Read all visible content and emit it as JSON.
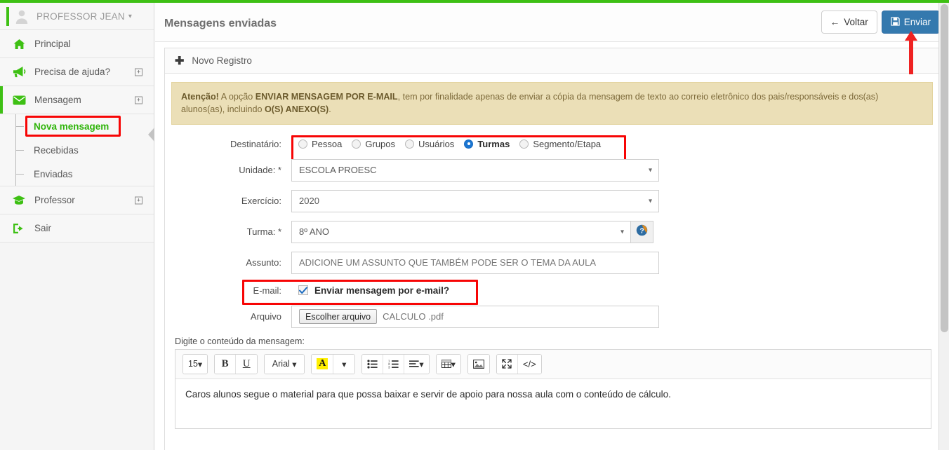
{
  "theme": {
    "brand_green": "#3ec014",
    "primary_blue": "#3479ae",
    "alert_bg": "#ebdfb7",
    "highlight_red": "#f70505",
    "radio_selected_blue": "#1b76d2"
  },
  "sidebar": {
    "user": {
      "name": "PROFESSOR JEAN",
      "caret": "chevron-down-icon"
    },
    "items": [
      {
        "label": "Principal",
        "icon": "home-icon",
        "expandable": false
      },
      {
        "label": "Precisa de ajuda?",
        "icon": "bullhorn-icon",
        "expandable": true
      },
      {
        "label": "Mensagem",
        "icon": "envelope-icon",
        "expandable": true
      }
    ],
    "submenu": [
      {
        "label": "Nova mensagem",
        "selected": true
      },
      {
        "label": "Recebidas",
        "selected": false
      },
      {
        "label": "Enviadas",
        "selected": false
      }
    ],
    "items_after": [
      {
        "label": "Professor",
        "icon": "graduation-cap-icon",
        "expandable": true
      },
      {
        "label": "Sair",
        "icon": "logout-icon",
        "expandable": false
      }
    ],
    "collapse_button": "collapse-sidebar-icon"
  },
  "header": {
    "title": "Mensagens enviadas",
    "back_label": "Voltar",
    "submit_label": "Enviar"
  },
  "panel": {
    "header_label": "Novo Registro",
    "alert": {
      "prefix_bold": "Atenção!",
      "text_1": " A opção ",
      "bold_1": "ENVIAR MENSAGEM POR E-MAIL",
      "text_2": ", tem por finalidade apenas de enviar a cópia da mensagem de texto ao correio eletrônico dos pais/responsáveis e dos(as) alunos(as), incluindo ",
      "bold_2": "O(S) ANEXO(S)",
      "text_3": "."
    }
  },
  "form": {
    "recipient": {
      "label": "Destinatário:",
      "options": [
        {
          "label": "Pessoa",
          "selected": false
        },
        {
          "label": "Grupos",
          "selected": false
        },
        {
          "label": "Usuários",
          "selected": false
        },
        {
          "label": "Turmas",
          "selected": true
        },
        {
          "label": "Segmento/Etapa",
          "selected": false
        }
      ]
    },
    "unidade": {
      "label": "Unidade: *",
      "value": "ESCOLA PROESC",
      "control": "select"
    },
    "exercicio": {
      "label": "Exercício:",
      "value": "2020",
      "control": "select"
    },
    "turma": {
      "label": "Turma: *",
      "value": "8º ANO",
      "control": "select",
      "help_icon": "question-circle-icon"
    },
    "assunto": {
      "label": "Assunto:",
      "value": "",
      "placeholder": "ADICIONE UM ASSUNTO QUE TAMBÉM PODE SER O TEMA DA AULA"
    },
    "email": {
      "label": "E-mail:",
      "checkbox_label": "Enviar mensagem por e-mail?",
      "checked": true
    },
    "arquivo": {
      "label": "Arquivo",
      "button_label": "Escolher arquivo",
      "file_name": "CALCULO .pdf"
    }
  },
  "editor": {
    "caption": "Digite o conteúdo da mensagem:",
    "toolbar": [
      {
        "name": "font-size-dropdown",
        "label": "15",
        "caret": true
      },
      {
        "name": "bold-button",
        "label": "B",
        "caret": false
      },
      {
        "name": "underline-button",
        "label": "U",
        "caret": false
      },
      {
        "name": "font-family-dropdown",
        "label": "Arial",
        "caret": true
      },
      {
        "name": "text-highlight-button",
        "label": "A",
        "caret": false
      },
      {
        "name": "text-color-dropdown",
        "label": "",
        "caret": true
      },
      {
        "name": "unordered-list-button",
        "label": "",
        "caret": false
      },
      {
        "name": "ordered-list-button",
        "label": "",
        "caret": false
      },
      {
        "name": "align-dropdown",
        "label": "",
        "caret": true
      },
      {
        "name": "table-dropdown",
        "label": "",
        "caret": true
      },
      {
        "name": "insert-image-button",
        "label": "",
        "caret": false
      },
      {
        "name": "fullscreen-button",
        "label": "",
        "caret": false
      },
      {
        "name": "source-code-button",
        "label": "</>",
        "caret": false
      }
    ],
    "content": "Caros alunos segue o material para que possa baixar e servir de apoio para nossa aula com o conteúdo de cálculo."
  },
  "annotations": {
    "arrow_to_submit": "red-up-arrow",
    "boxes": [
      "nova-mensagem-menu",
      "destinatario-radios",
      "email-checkbox"
    ]
  }
}
